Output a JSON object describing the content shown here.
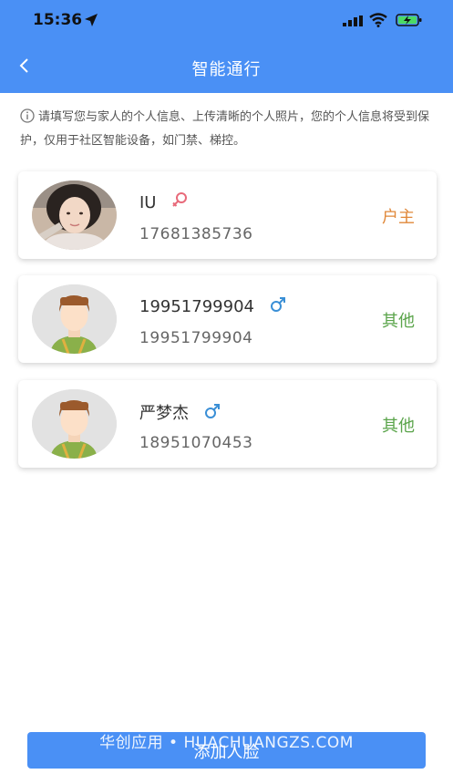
{
  "status": {
    "time": "15:36"
  },
  "header": {
    "title": "智能通行"
  },
  "notice": {
    "text": "请填写您与家人的个人信息、上传清晰的个人照片，您的个人信息将受到保护，仅用于社区智能设备，如门禁、梯控。"
  },
  "members": [
    {
      "name": "IU",
      "gender": "female",
      "phone": "17681385736",
      "role": "户主",
      "avatar": "photo"
    },
    {
      "name": "19951799904",
      "gender": "male",
      "phone": "19951799904",
      "role": "其他",
      "avatar": "default-avatar"
    },
    {
      "name": "严梦杰",
      "gender": "male",
      "phone": "18951070453",
      "role": "其他",
      "avatar": "default-avatar"
    }
  ],
  "footer": {
    "add_button": "添加人脸",
    "watermark": "华创应用 • HUACHUANGZS.COM"
  },
  "colors": {
    "primary": "#4a90f5",
    "owner": "#e0883a",
    "other": "#5aa44a",
    "female": "#e86a7a",
    "male": "#3a8fd6"
  }
}
